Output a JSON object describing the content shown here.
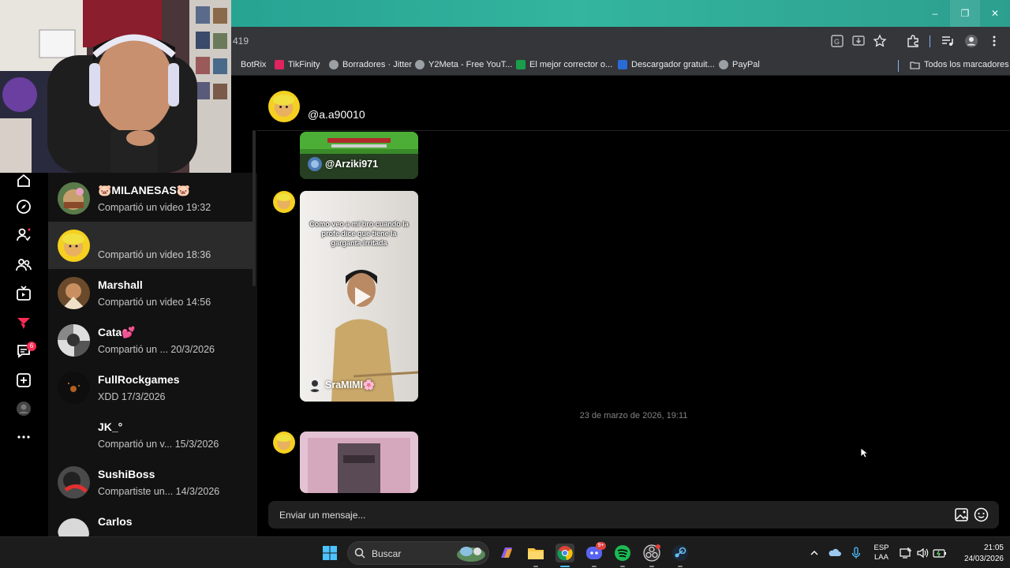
{
  "browser": {
    "url_fragment": "419",
    "window_buttons": {
      "minimize": "–",
      "restore": "❐",
      "close": "✕"
    },
    "bookmarks": [
      {
        "label": "BotRix",
        "color": "#2f2f2f"
      },
      {
        "label": "TikFinity",
        "color": "#e0245e"
      },
      {
        "label": "Borradores · Jitter",
        "color": "#9aa0a6"
      },
      {
        "label": "Y2Meta - Free YouT...",
        "color": "#9aa0a6"
      },
      {
        "label": "El mejor corrector o...",
        "color": "#1a9e4b"
      },
      {
        "label": "Descargador gratuit...",
        "color": "#2a6bd8"
      },
      {
        "label": "PayPal",
        "color": "#9aa0a6"
      }
    ],
    "all_bookmarks_label": "Todos los marcadores"
  },
  "rail": {
    "notification_badge": "6",
    "icons": [
      "home-icon",
      "explore-icon",
      "following-icon",
      "friends-icon",
      "live-icon",
      "upload-icon",
      "messages-icon",
      "add-icon",
      "profile-icon",
      "more-icon"
    ]
  },
  "conversations": [
    {
      "name": "🐷MILANESAS🐷",
      "subtitle": "Compartió un video 19:32",
      "active": false
    },
    {
      "name": "",
      "subtitle": "Compartió un video 18:36",
      "active": true
    },
    {
      "name": "Marshall",
      "subtitle": "Compartió un video 14:56",
      "active": false
    },
    {
      "name": "Cata💕",
      "subtitle": "Compartió un ...  20/3/2026",
      "active": false
    },
    {
      "name": "FullRockgames",
      "subtitle": "XDD 17/3/2026",
      "active": false
    },
    {
      "name": "JK_°",
      "subtitle": "Compartió un v...  15/3/2026",
      "active": false
    },
    {
      "name": "SushiBoss",
      "subtitle": "Compartiste un...  14/3/2026",
      "active": false
    },
    {
      "name": "Carlos",
      "subtitle": "",
      "active": false
    }
  ],
  "chat": {
    "handle": "@a.a90010",
    "messages": [
      {
        "type": "video",
        "author": "@Arziki971",
        "caption": ""
      },
      {
        "type": "video",
        "author": "SraMIMI🌸",
        "caption": "Como veo a mi bro cuando la profe dice que tiene la garganta irritada"
      },
      {
        "type": "date",
        "text": "23 de marzo de 2026, 19:11"
      },
      {
        "type": "video",
        "author": "",
        "caption": ""
      }
    ],
    "composer_placeholder": "Enviar un mensaje..."
  },
  "taskbar": {
    "search_label": "Buscar",
    "lang_top": "ESP",
    "lang_bottom": "LAA",
    "time": "21:05",
    "date": "24/03/2026",
    "discord_badge": "9+"
  },
  "colors": {
    "accent": "#fe2c55",
    "titlebar": "#2e9d8f",
    "chrome": "#35363a"
  }
}
